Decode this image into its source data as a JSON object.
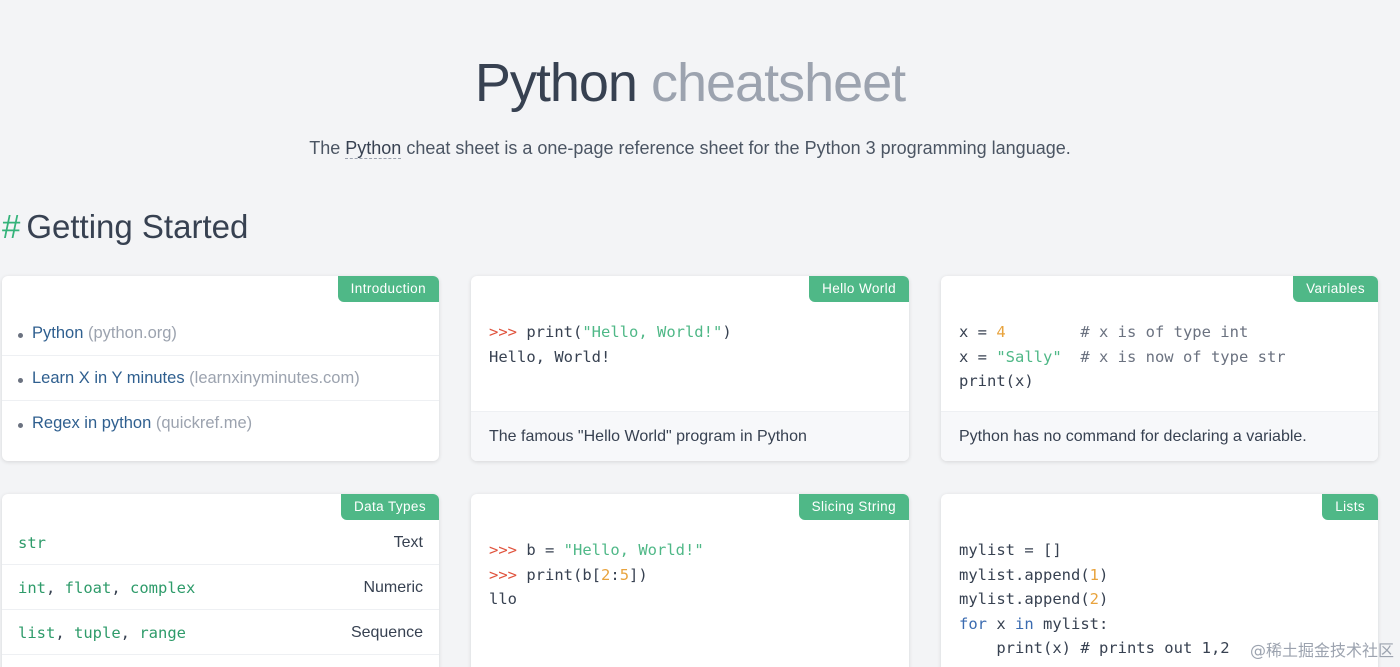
{
  "header": {
    "title_main": "Python",
    "title_rest": "cheatsheet",
    "intro_prefix": "The ",
    "intro_link": "Python",
    "intro_suffix": " cheat sheet is a one-page reference sheet for the Python 3 programming language."
  },
  "section": {
    "hash": "#",
    "title": "Getting Started"
  },
  "cards": {
    "introduction": {
      "tag": "Introduction",
      "links": [
        {
          "label": "Python",
          "domain": "(python.org)"
        },
        {
          "label": "Learn X in Y minutes",
          "domain": "(learnxinyminutes.com)"
        },
        {
          "label": "Regex in python",
          "domain": "(quickref.me)"
        }
      ]
    },
    "hello_world": {
      "tag": "Hello World",
      "prompt": ">>>",
      "l1_code": " print(",
      "l1_str": "\"Hello, World!\"",
      "l1_end": ")",
      "l2": "Hello, World!",
      "footer": "The famous \"Hello World\" program in Python"
    },
    "variables": {
      "tag": "Variables",
      "l1_a": "x = ",
      "l1_num": "4",
      "l1_cmt": "        # x is of type int",
      "l2_a": "x = ",
      "l2_str": "\"Sally\"",
      "l2_cmt": "  # x is now of type str",
      "l3": "print(x)",
      "footer": "Python has no command for declaring a variable."
    },
    "data_types": {
      "tag": "Data Types",
      "rows": [
        {
          "types": [
            "str"
          ],
          "desc": "Text"
        },
        {
          "types": [
            "int",
            "float",
            "complex"
          ],
          "desc": "Numeric"
        },
        {
          "types": [
            "list",
            "tuple",
            "range"
          ],
          "desc": "Sequence"
        }
      ],
      "sep": ", "
    },
    "slicing": {
      "tag": "Slicing String",
      "prompt": ">>>",
      "l1_code": " b = ",
      "l1_str": "\"Hello, World!\"",
      "l2_code": " print(b[",
      "l2_n1": "2",
      "l2_colon": ":",
      "l2_n2": "5",
      "l2_end": "])",
      "l3": "llo"
    },
    "lists": {
      "tag": "Lists",
      "l1": "mylist = []",
      "l2_a": "mylist.append(",
      "l2_n": "1",
      "l2_b": ")",
      "l3_a": "mylist.append(",
      "l3_n": "2",
      "l3_b": ")",
      "l4_kw1": "for",
      "l4_mid": " x ",
      "l4_kw2": "in",
      "l4_end": " mylist:",
      "l5": "    print(x) # prints out 1,2"
    }
  },
  "watermark": "@稀土掘金技术社区"
}
